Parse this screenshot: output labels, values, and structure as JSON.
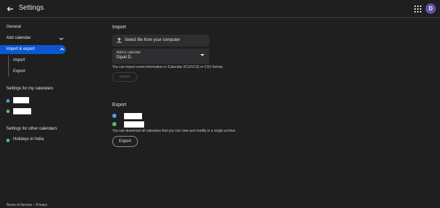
{
  "header": {
    "title": "Settings",
    "avatar_letter": "D"
  },
  "sidebar": {
    "general": "General",
    "add_calendar": "Add calendar",
    "import_export": "Import & export",
    "import": "Import",
    "export": "Export",
    "my_calendars_title": "Settings for my calendars",
    "other_calendars_title": "Settings for other calendars",
    "holidays": "Holidays in India"
  },
  "import": {
    "title": "Import",
    "select_file": "Select file from your computer",
    "add_to_label": "Add to calendar",
    "add_to_value": "Dipali D.",
    "info": "You can import event information in iCalendar (ICS/VCS) or CSV format.",
    "button": "Import"
  },
  "export": {
    "title": "Export",
    "info": "You can download all calendars that you can view and modify in a single archive.",
    "button": "Export"
  },
  "footer": {
    "links": "Terms of Service – Privacy"
  },
  "colors": {
    "accent": "#0b57d0",
    "dot_blue": "#4fa3e0",
    "dot_green": "#5bb974",
    "avatar": "#6750a4"
  }
}
